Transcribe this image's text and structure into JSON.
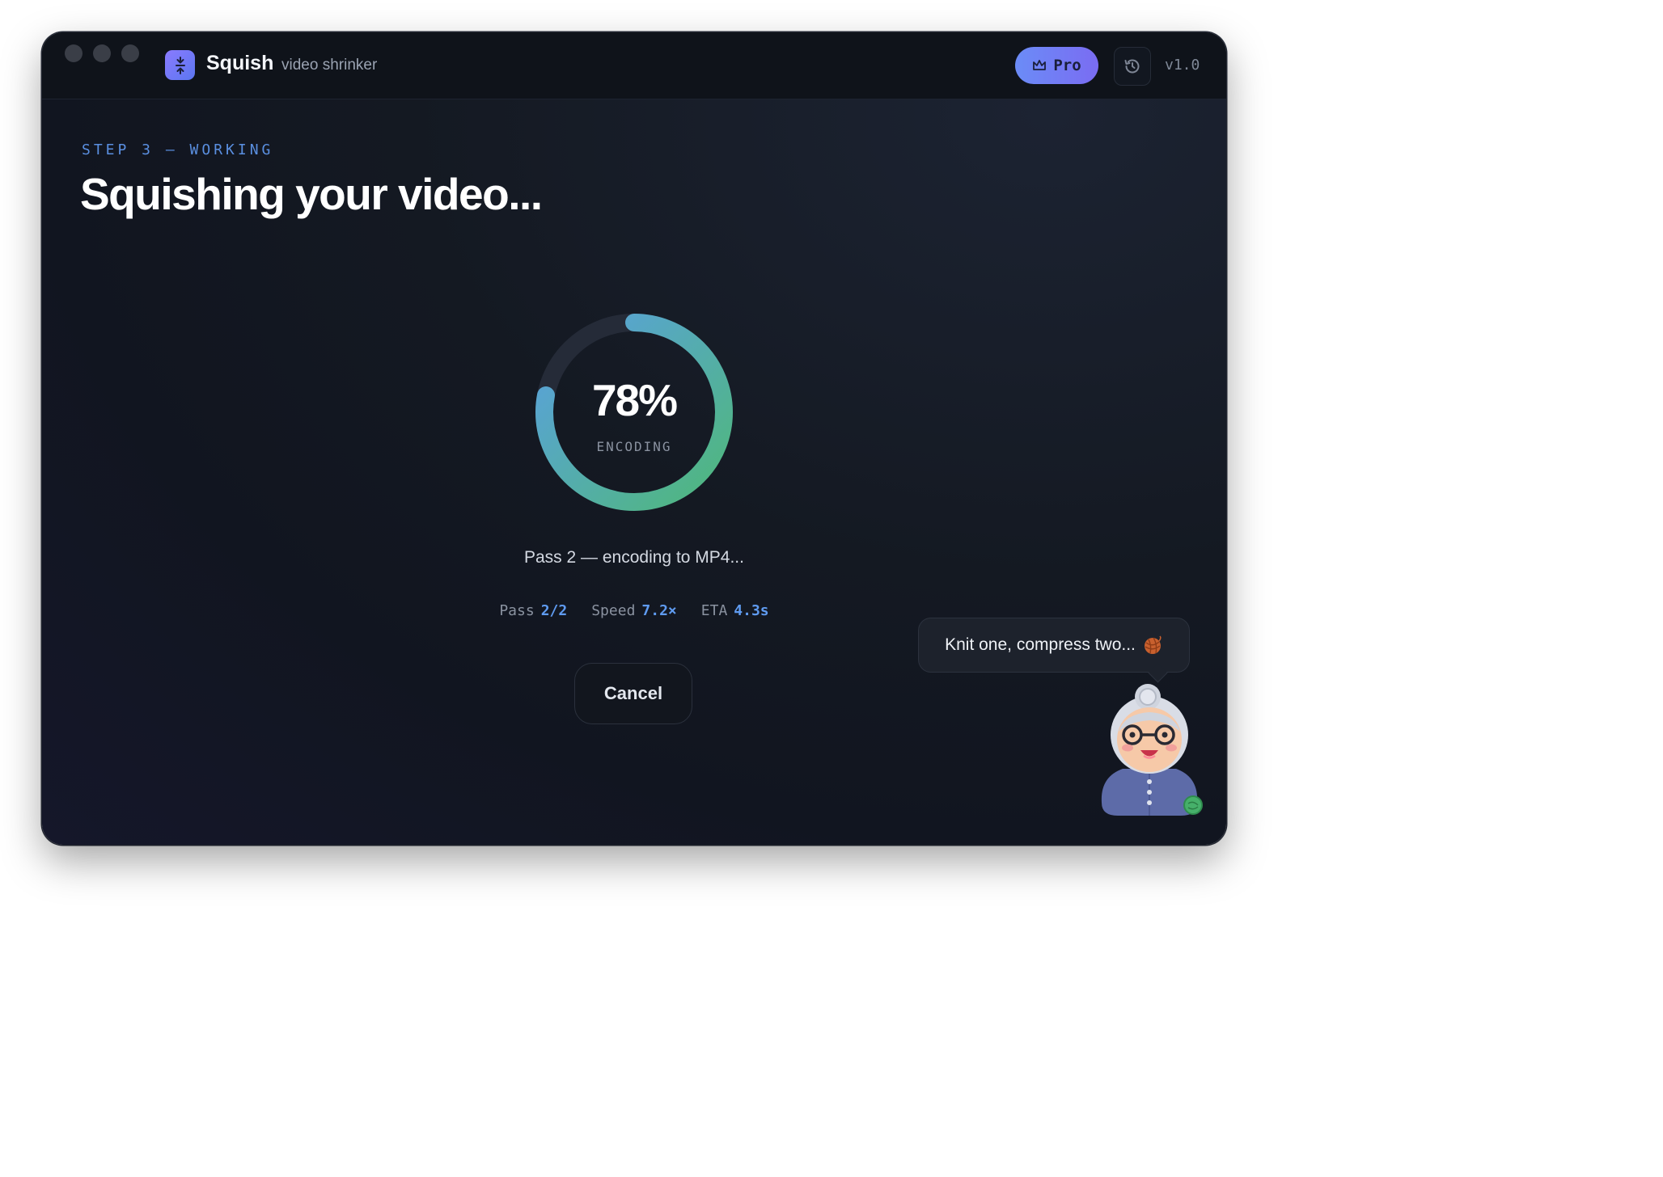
{
  "titlebar": {
    "app_name": "Squish",
    "app_subtitle": "video shrinker",
    "pro_label": "Pro",
    "version": "v1.0",
    "icons": {
      "app": "compress-arrows-icon",
      "pro": "crown-icon",
      "history": "history-clock-icon"
    }
  },
  "main": {
    "step_label": "STEP 3 — WORKING",
    "headline": "Squishing your video..."
  },
  "progress": {
    "percent_text": "78%",
    "percent": 78,
    "label": "ENCODING",
    "status_text": "Pass 2 — encoding to MP4...",
    "colors": {
      "track": "#252b38",
      "start": "#4fb87a",
      "end": "#5aa0e2"
    }
  },
  "stats": [
    {
      "label": "Pass",
      "value": "2/2"
    },
    {
      "label": "Speed",
      "value": "7.2×"
    },
    {
      "label": "ETA",
      "value": "4.3s"
    }
  ],
  "actions": {
    "cancel_label": "Cancel"
  },
  "mascot": {
    "speech": "Knit one, compress two...",
    "speech_icon": "yarn-ball-icon",
    "status_icon": "online-dot-icon"
  }
}
